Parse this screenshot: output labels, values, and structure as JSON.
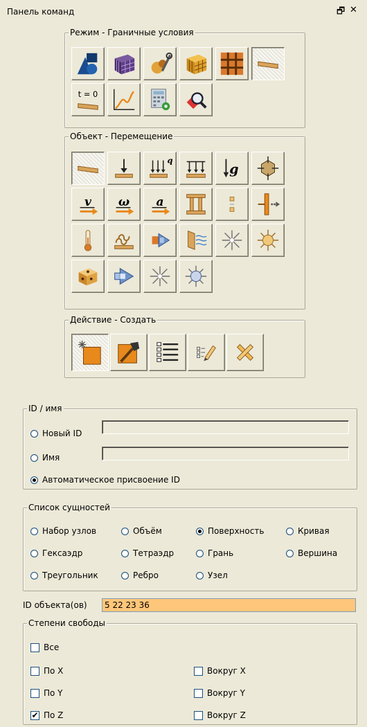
{
  "panel": {
    "title": "Панель команд",
    "restore_glyph": "🗗",
    "close_glyph": "✕"
  },
  "mode": {
    "legend": "Режим - Граничные условия",
    "tools": [
      "geometry-icon",
      "mesh-icon",
      "materials-icon",
      "elements-icon",
      "blocks-icon",
      "boundary-conditions-icon",
      "initial-conditions-icon",
      "curve-icon",
      "analysis-icon",
      "search-icon"
    ],
    "initial_label": "t = 0"
  },
  "object": {
    "legend": "Объект - Перемещение",
    "tools": [
      "displacement-icon",
      "force-icon",
      "pressure-icon",
      "distributed-load-icon",
      "gravity-icon",
      "constraint-icon",
      "velocity-icon",
      "angular-velocity-icon",
      "acceleration-icon",
      "rigid-body-icon",
      "contact-icon",
      "spring-icon",
      "temperature-icon",
      "heat-flux-icon",
      "convection-icon",
      "radiation-icon",
      "heat-source-icon",
      "light-source-icon",
      "volume-heat-icon",
      "fluid-flow-icon",
      "point-source-icon",
      "sun-icon"
    ],
    "pressure_label": "q",
    "gravity_label": "g",
    "velocity_label": "v",
    "angular_label": "ω",
    "acceleration_label": "a"
  },
  "action": {
    "legend": "Действие - Создать",
    "tools": [
      "create-icon",
      "modify-icon",
      "list-icon",
      "edit-icon",
      "delete-icon"
    ]
  },
  "id_name": {
    "legend": "ID / имя",
    "new_id_label": "Новый ID",
    "name_label": "Имя",
    "auto_label": "Автоматическое присвоение ID",
    "new_id_value": "",
    "name_value": "",
    "selected": "auto"
  },
  "entities": {
    "legend": "Список сущностей",
    "options": [
      "Набор узлов",
      "Объём",
      "Поверхность",
      "Кривая",
      "Гексаэдр",
      "Тетраэдр",
      "Грань",
      "Вершина",
      "Треугольник",
      "Ребро",
      "Узел"
    ],
    "selected": "Поверхность"
  },
  "object_ids": {
    "label": "ID объекта(ов)",
    "value": "5 22 23 36"
  },
  "dof": {
    "legend": "Степени свободы",
    "all": "Все",
    "x": "По X",
    "y": "По Y",
    "z": "По Z",
    "rx": "Вокруг X",
    "ry": "Вокруг Y",
    "rz": "Вокруг Z",
    "checked": {
      "all": false,
      "x": false,
      "y": false,
      "z": true,
      "rx": false,
      "ry": false,
      "rz": false
    }
  },
  "colors": {
    "background": "#ece9d8",
    "highlight_field": "#fec67a",
    "tan": "#d9a45a",
    "orange": "#e8891c"
  }
}
